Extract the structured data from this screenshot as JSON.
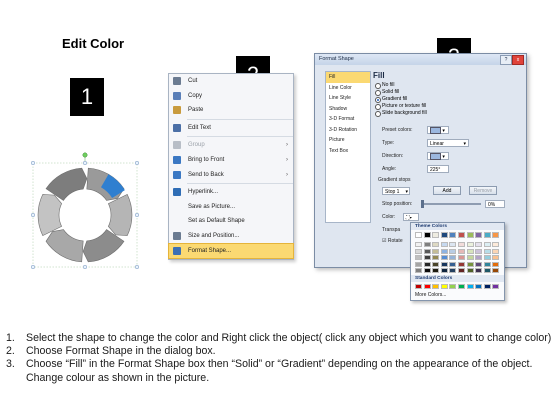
{
  "page": {
    "title": "Edit Color"
  },
  "steps": [
    "1",
    "2",
    "3"
  ],
  "context_menu": {
    "items": [
      {
        "label": "Cut",
        "icon": "scissors-icon",
        "icon_color": "#6b7b91",
        "disabled": false,
        "submenu": false,
        "highlight": false
      },
      {
        "label": "Copy",
        "icon": "copy-icon",
        "icon_color": "#5a7fb8",
        "disabled": false,
        "submenu": false,
        "highlight": false
      },
      {
        "label": "Paste",
        "icon": "paste-icon",
        "icon_color": "#c99b3d",
        "disabled": false,
        "submenu": false,
        "highlight": false
      },
      {
        "separator": true
      },
      {
        "label": "Edit Text",
        "icon": "edit-text-icon",
        "icon_color": "#4b6fa6",
        "disabled": false,
        "submenu": false,
        "highlight": false
      },
      {
        "separator": true
      },
      {
        "label": "Group",
        "icon": "group-icon",
        "icon_color": "#b8bec7",
        "disabled": true,
        "submenu": true,
        "highlight": false
      },
      {
        "label": "Bring to Front",
        "icon": "bring-to-front-icon",
        "icon_color": "#3b78c3",
        "disabled": false,
        "submenu": true,
        "highlight": false
      },
      {
        "label": "Send to Back",
        "icon": "send-to-back-icon",
        "icon_color": "#3b78c3",
        "disabled": false,
        "submenu": true,
        "highlight": false
      },
      {
        "separator": true
      },
      {
        "label": "Hyperlink...",
        "icon": "hyperlink-icon",
        "icon_color": "#2f6db5",
        "disabled": false,
        "submenu": false,
        "highlight": false
      },
      {
        "label": "Save as Picture...",
        "icon": "",
        "icon_color": "",
        "disabled": false,
        "submenu": false,
        "highlight": false
      },
      {
        "label": "Set as Default Shape",
        "icon": "",
        "icon_color": "",
        "disabled": false,
        "submenu": false,
        "highlight": false
      },
      {
        "label": "Size and Position...",
        "icon": "size-position-icon",
        "icon_color": "#6b7b91",
        "disabled": false,
        "submenu": false,
        "highlight": false
      },
      {
        "label": "Format Shape...",
        "icon": "format-shape-icon",
        "icon_color": "#3c6fb4",
        "disabled": false,
        "submenu": false,
        "highlight": true
      }
    ]
  },
  "dialog": {
    "title": "Format Shape",
    "help": "?",
    "close": "x",
    "nav": [
      "Fill",
      "Line Color",
      "Line Style",
      "Shadow",
      "3-D Format",
      "3-D Rotation",
      "Picture",
      "Text Box"
    ],
    "nav_selected": 0,
    "panel_title": "Fill",
    "fill_options": [
      {
        "label": "No fill",
        "checked": false
      },
      {
        "label": "Solid fill",
        "checked": false
      },
      {
        "label": "Gradient fill",
        "checked": true
      },
      {
        "label": "Picture or texture fill",
        "checked": false
      },
      {
        "label": "Slide background fill",
        "checked": false
      }
    ],
    "preset_colors_label": "Preset colors:",
    "type_label": "Type:",
    "type_value": "Linear",
    "direction_label": "Direction:",
    "angle_label": "Angle:",
    "angle_value": "225°",
    "gradient_stops_label": "Gradient stops",
    "stop_value": "Stop 1",
    "add_button": "Add",
    "remove_button": "Remove",
    "stop_position_label": "Stop position:",
    "stop_position_value": "0%",
    "stop_position": 0.0,
    "color_label": "Color:",
    "transparency_label": "Transpa",
    "rotate_label": "Rotate"
  },
  "color_popup": {
    "theme_header": "Theme Colors",
    "standard_header": "Standard Colors",
    "more_colors": "More Colors...",
    "theme_top": [
      "#ffffff",
      "#000000",
      "#eeece1",
      "#1f497d",
      "#4f81bd",
      "#c0504d",
      "#9bbb59",
      "#8064a2",
      "#4bacc6",
      "#f79646"
    ],
    "theme_shades": [
      [
        "#f2f2f2",
        "#7f7f7f",
        "#ddd9c3",
        "#c6d9f0",
        "#dbe5f1",
        "#f2dcdb",
        "#ebf1dd",
        "#e5e0ec",
        "#dbeef3",
        "#fdeada"
      ],
      [
        "#d8d8d8",
        "#595959",
        "#c4bd97",
        "#8db3e2",
        "#b8cce4",
        "#e5b9b7",
        "#d7e3bc",
        "#ccc1d9",
        "#b7dde8",
        "#fbd5b5"
      ],
      [
        "#bfbfbf",
        "#3f3f3f",
        "#938953",
        "#548dd4",
        "#95b3d7",
        "#d99694",
        "#c3d69b",
        "#b2a2c7",
        "#92cddc",
        "#fac08f"
      ],
      [
        "#a5a5a5",
        "#262626",
        "#494429",
        "#17365d",
        "#366092",
        "#953734",
        "#76923c",
        "#5f497a",
        "#31859b",
        "#e36c09"
      ],
      [
        "#7f7f7f",
        "#0c0c0c",
        "#1d1b10",
        "#0f243e",
        "#244061",
        "#632423",
        "#4f6128",
        "#3f3151",
        "#205867",
        "#974806"
      ]
    ],
    "standard": [
      "#c00000",
      "#ff0000",
      "#ffc000",
      "#ffff00",
      "#92d050",
      "#00b050",
      "#00b0f0",
      "#0070c0",
      "#002060",
      "#7030a0"
    ]
  },
  "ring": {
    "segment_colors": [
      "#9a9a9a",
      "#b5b5b5",
      "#8c8c8c",
      "#a8a8a8",
      "#c3c3c3",
      "#7d7d7d"
    ],
    "highlight_color": "#2f7fd0"
  },
  "instructions": [
    {
      "num": "1.",
      "text": "Select the shape to change the color and Right click the object( click any object which you want to change color)"
    },
    {
      "num": "2.",
      "text": "Choose Format Shape in the dialog box."
    },
    {
      "num": "3.",
      "text": "Choose “Fill” in the Format Shape box then “Solid” or “Gradient” depending on the appearance of the object. Change colour as shown in the picture."
    }
  ]
}
